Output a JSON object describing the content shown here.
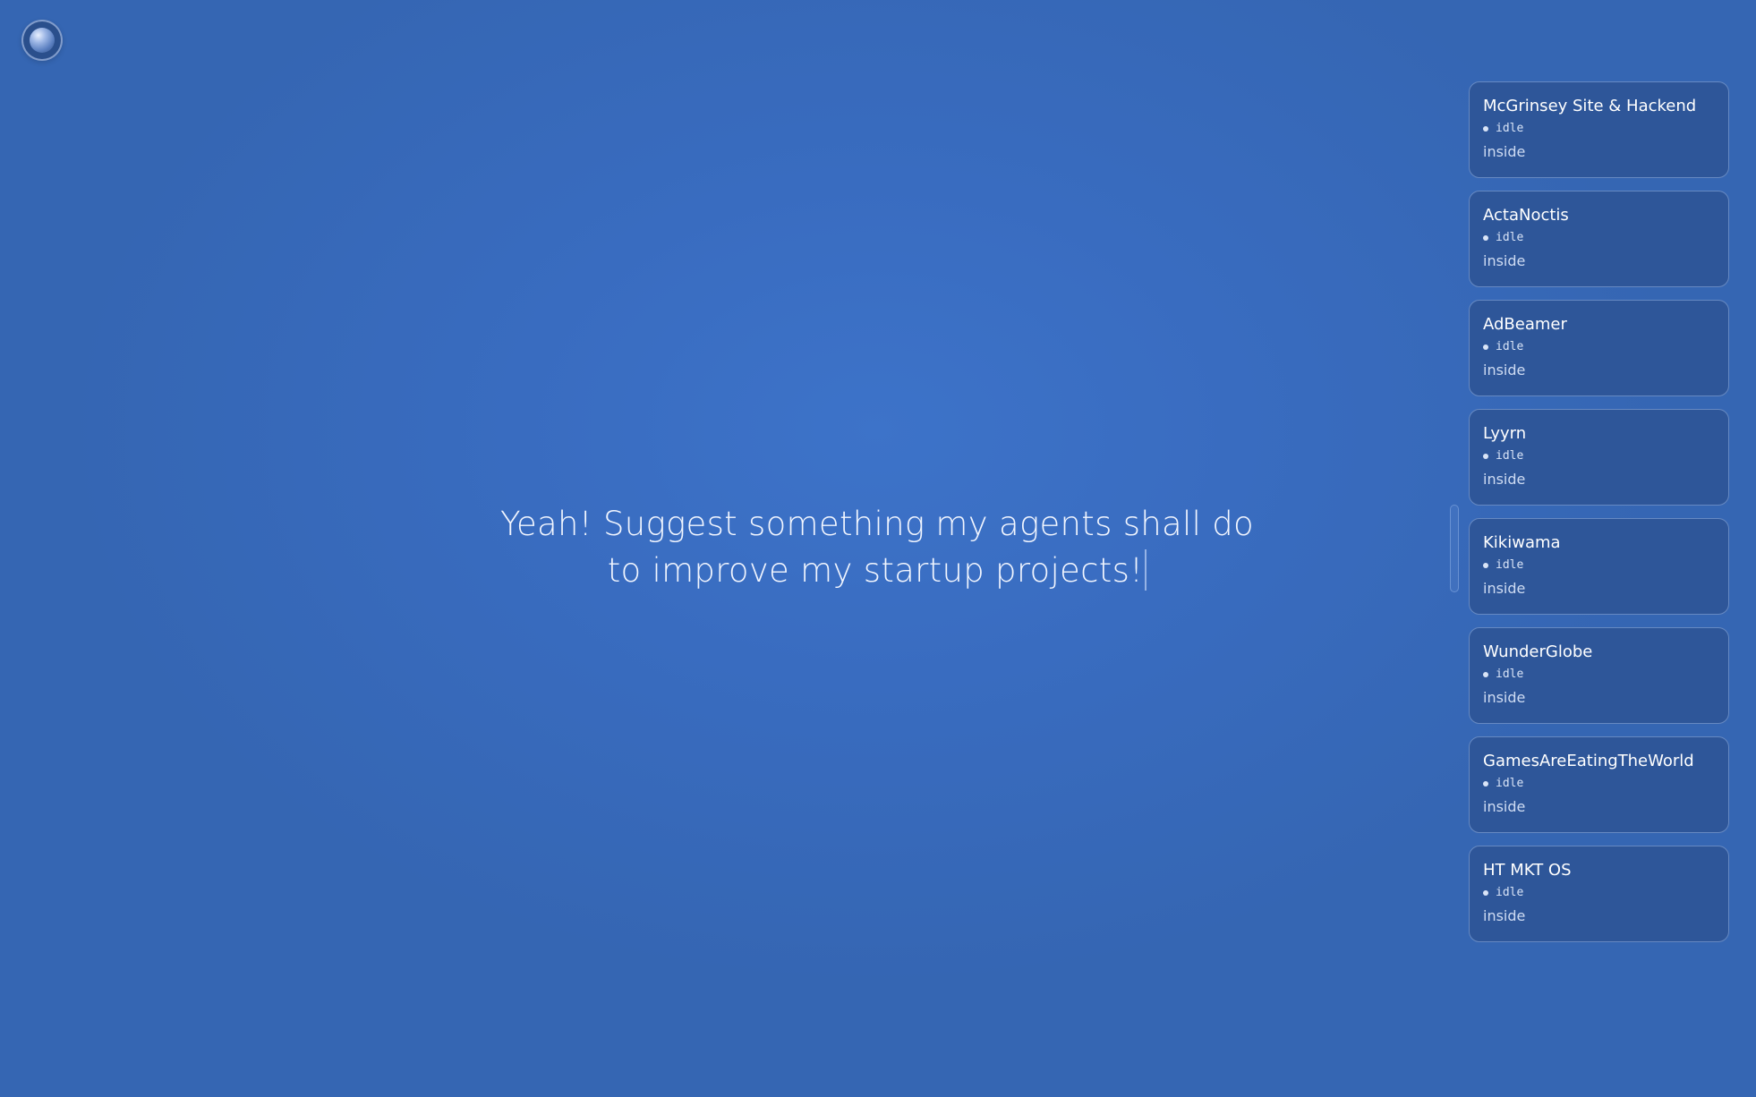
{
  "prompt": {
    "line1": "Yeah! Suggest something my agents shall do",
    "line2": "to improve my startup projects!"
  },
  "icons": {
    "orb": "orb-icon"
  },
  "colors": {
    "background": "#396cc0",
    "card_background": "#2e5699",
    "card_border": "#aac8f5"
  },
  "agents": [
    {
      "name": "McGrinsey Site & Hackend",
      "status": "idle",
      "location": "inside"
    },
    {
      "name": "ActaNoctis",
      "status": "idle",
      "location": "inside"
    },
    {
      "name": "AdBeamer",
      "status": "idle",
      "location": "inside"
    },
    {
      "name": "Lyyrn",
      "status": "idle",
      "location": "inside"
    },
    {
      "name": "Kikiwama",
      "status": "idle",
      "location": "inside"
    },
    {
      "name": "WunderGlobe",
      "status": "idle",
      "location": "inside"
    },
    {
      "name": "GamesAreEatingTheWorld",
      "status": "idle",
      "location": "inside"
    },
    {
      "name": "HT MKT OS",
      "status": "idle",
      "location": "inside"
    }
  ]
}
